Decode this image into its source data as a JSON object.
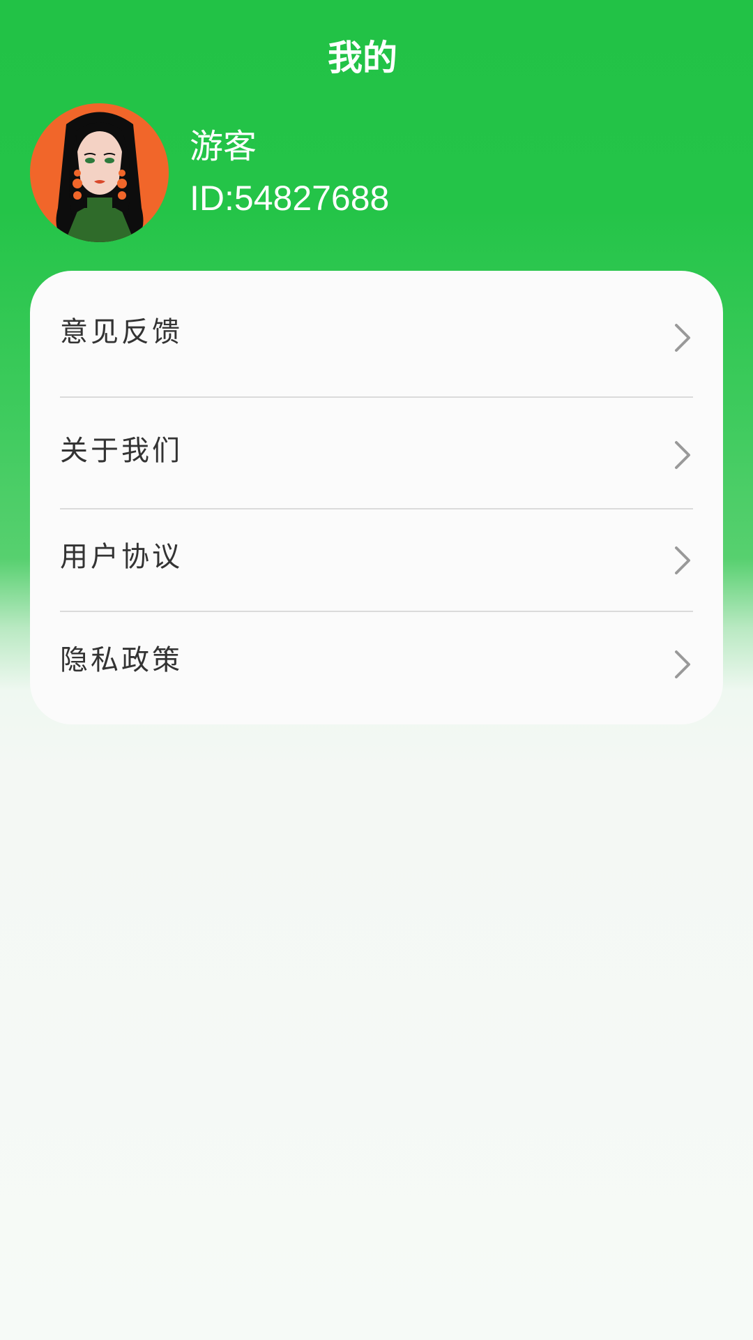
{
  "header": {
    "title": "我的"
  },
  "profile": {
    "name": "游客",
    "id_text": "ID:54827688",
    "avatar_icon": "avatar-woman-illustration"
  },
  "menu": {
    "items": [
      {
        "label": "意见反馈",
        "icon": "chevron-right-icon"
      },
      {
        "label": "关于我们",
        "icon": "chevron-right-icon"
      },
      {
        "label": "用户协议",
        "icon": "chevron-right-icon"
      },
      {
        "label": "隐私政策",
        "icon": "chevron-right-icon"
      }
    ]
  },
  "colors": {
    "header_green": "#22c246",
    "card_bg": "#fbfbfb",
    "menu_text": "#333333",
    "chevron": "#999999"
  }
}
